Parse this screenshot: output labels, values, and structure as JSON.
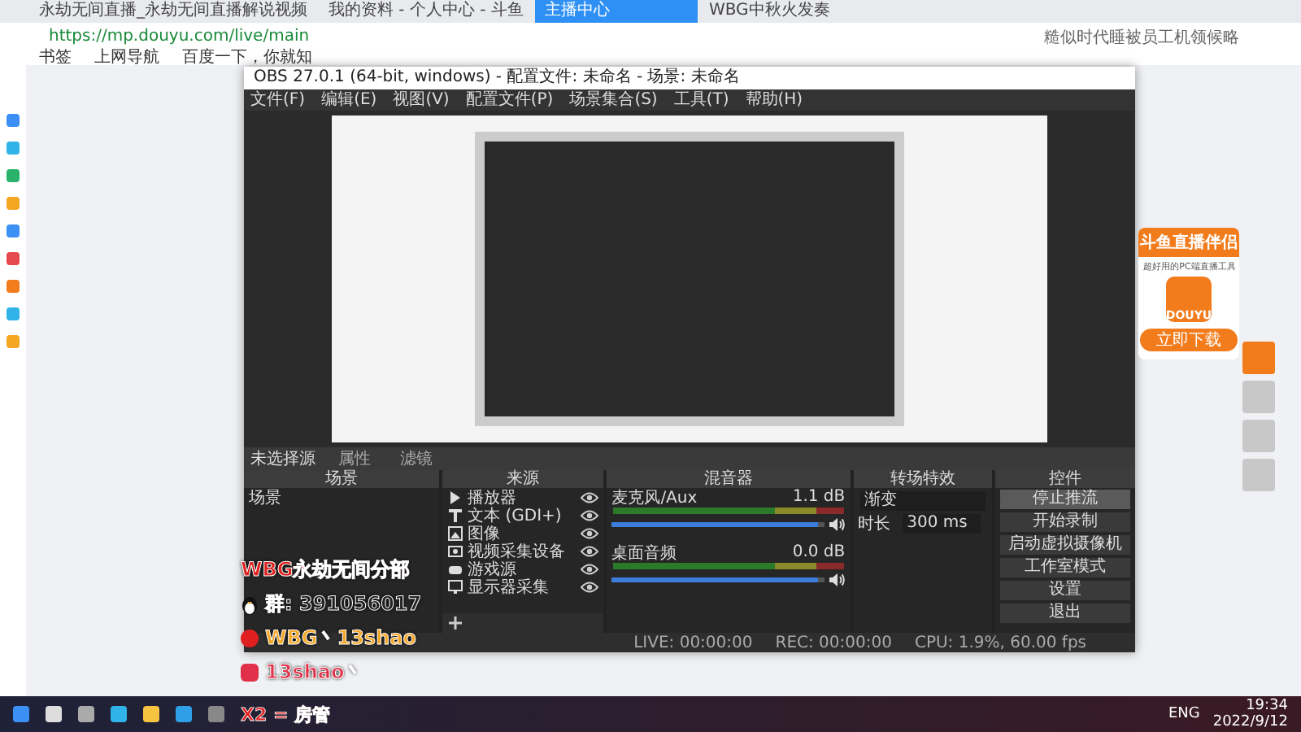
{
  "browser": {
    "tabs": [
      {
        "label": "永劫无间直播_永劫无间直播解说视频",
        "selected": false
      },
      {
        "label": "我的资料 - 个人中心 - 斗鱼",
        "selected": false
      },
      {
        "label": "主播中心",
        "selected": true
      },
      {
        "label": "WBG中秋火发奏",
        "selected": false
      }
    ],
    "url": "https://mp.douyu.com/live/main",
    "search_hint": "糙似时代睡被员工机领候略",
    "bookmarks": [
      "书签",
      "上网导航",
      "百度一下，你就知"
    ]
  },
  "obs": {
    "title": "OBS 27.0.1 (64-bit, windows) - 配置文件: 未命名 - 场景: 未命名",
    "menu": [
      "文件(F)",
      "编辑(E)",
      "视图(V)",
      "配置文件(P)",
      "场景集合(S)",
      "工具(T)",
      "帮助(H)"
    ],
    "source_bar": {
      "label": "未选择源",
      "buttons": [
        "属性",
        "滤镜"
      ]
    },
    "scenes": {
      "title": "场景",
      "items": [
        "场景"
      ]
    },
    "sources": {
      "title": "来源",
      "items": [
        {
          "name": "播放器",
          "kind": "media"
        },
        {
          "name": "文本 (GDI+)",
          "kind": "text"
        },
        {
          "name": "图像",
          "kind": "image"
        },
        {
          "name": "视频采集设备",
          "kind": "camera"
        },
        {
          "name": "游戏源",
          "kind": "game"
        },
        {
          "name": "显示器采集",
          "kind": "display"
        }
      ]
    },
    "mixer": {
      "title": "混音器",
      "channels": [
        {
          "name": "麦克风/Aux",
          "reading": "1.1 dB",
          "level": 0.97
        },
        {
          "name": "桌面音频",
          "reading": "0.0 dB",
          "level": 0.97
        }
      ]
    },
    "transitions": {
      "title": "转场特效",
      "type": "渐变",
      "duration_label": "时长",
      "duration": "300 ms"
    },
    "controls": {
      "title": "控件",
      "buttons": [
        {
          "label": "停止推流",
          "selected": true
        },
        {
          "label": "开始录制",
          "selected": false
        },
        {
          "label": "启动虚拟摄像机",
          "selected": false
        },
        {
          "label": "工作室模式",
          "selected": false
        },
        {
          "label": "设置",
          "selected": false
        },
        {
          "label": "退出",
          "selected": false
        }
      ]
    },
    "status": {
      "live": "LIVE: 00:00:00",
      "rec": "REC: 00:00:00",
      "cpu": "CPU: 1.9%, 60.00 fps"
    }
  },
  "overlay": {
    "group_name": "WBG永劫无间分部",
    "qq_group": "群: 391056017",
    "weibo": "WBG丶13shao",
    "douyu": "13shao丶",
    "sticker": "X2 = 房管"
  },
  "ad": {
    "title": "斗鱼直播伴侣",
    "subtitle": "超好用的PC端直播工具",
    "logo": "DOUYU",
    "button": "立即下载"
  },
  "taskbar": {
    "lang": "ENG",
    "time": "19:34",
    "date": "2022/9/12"
  }
}
